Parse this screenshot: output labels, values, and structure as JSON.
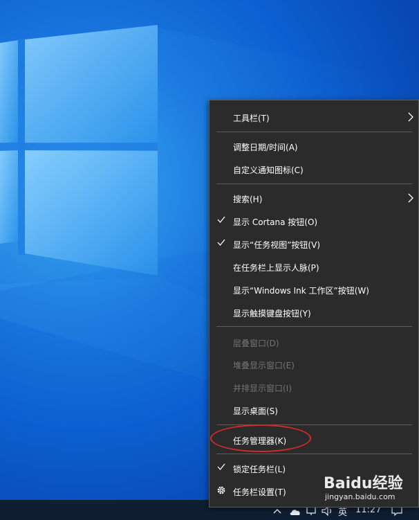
{
  "menu": {
    "items": [
      {
        "label": "工具栏(T)",
        "checked": false,
        "submenu": true,
        "disabled": false
      },
      {
        "label": "调整日期/时间(A)",
        "checked": false,
        "submenu": false,
        "disabled": false
      },
      {
        "label": "自定义通知图标(C)",
        "checked": false,
        "submenu": false,
        "disabled": false
      },
      {
        "label": "搜索(H)",
        "checked": false,
        "submenu": true,
        "disabled": false
      },
      {
        "label": "显示 Cortana 按钮(O)",
        "checked": true,
        "submenu": false,
        "disabled": false
      },
      {
        "label": "显示“任务视图”按钮(V)",
        "checked": true,
        "submenu": false,
        "disabled": false
      },
      {
        "label": "在任务栏上显示人脉(P)",
        "checked": false,
        "submenu": false,
        "disabled": false
      },
      {
        "label": "显示“Windows Ink 工作区”按钮(W)",
        "checked": false,
        "submenu": false,
        "disabled": false
      },
      {
        "label": "显示触摸键盘按钮(Y)",
        "checked": false,
        "submenu": false,
        "disabled": false
      },
      {
        "label": "层叠窗口(D)",
        "checked": false,
        "submenu": false,
        "disabled": true
      },
      {
        "label": "堆叠显示窗口(E)",
        "checked": false,
        "submenu": false,
        "disabled": true
      },
      {
        "label": "并排显示窗口(I)",
        "checked": false,
        "submenu": false,
        "disabled": true
      },
      {
        "label": "显示桌面(S)",
        "checked": false,
        "submenu": false,
        "disabled": false
      },
      {
        "label": "任务管理器(K)",
        "checked": false,
        "submenu": false,
        "disabled": false,
        "highlighted": true
      },
      {
        "label": "锁定任务栏(L)",
        "checked": true,
        "submenu": false,
        "disabled": false
      },
      {
        "label": "任务栏设置(T)",
        "checked": false,
        "submenu": false,
        "disabled": false,
        "icon": "gear-icon"
      }
    ]
  },
  "taskbar": {
    "input_method": "英",
    "clock": "11:27"
  },
  "watermark": {
    "brand": "Baidu经验",
    "url": "jingyan.baidu.com"
  },
  "colors": {
    "menu_bg": "#2b2b2b",
    "menu_text": "#ffffff",
    "menu_disabled_text": "#747474",
    "separator": "#5c5c5c",
    "highlight_ellipse": "#d12a2a",
    "taskbar_bg": "#101e33"
  }
}
